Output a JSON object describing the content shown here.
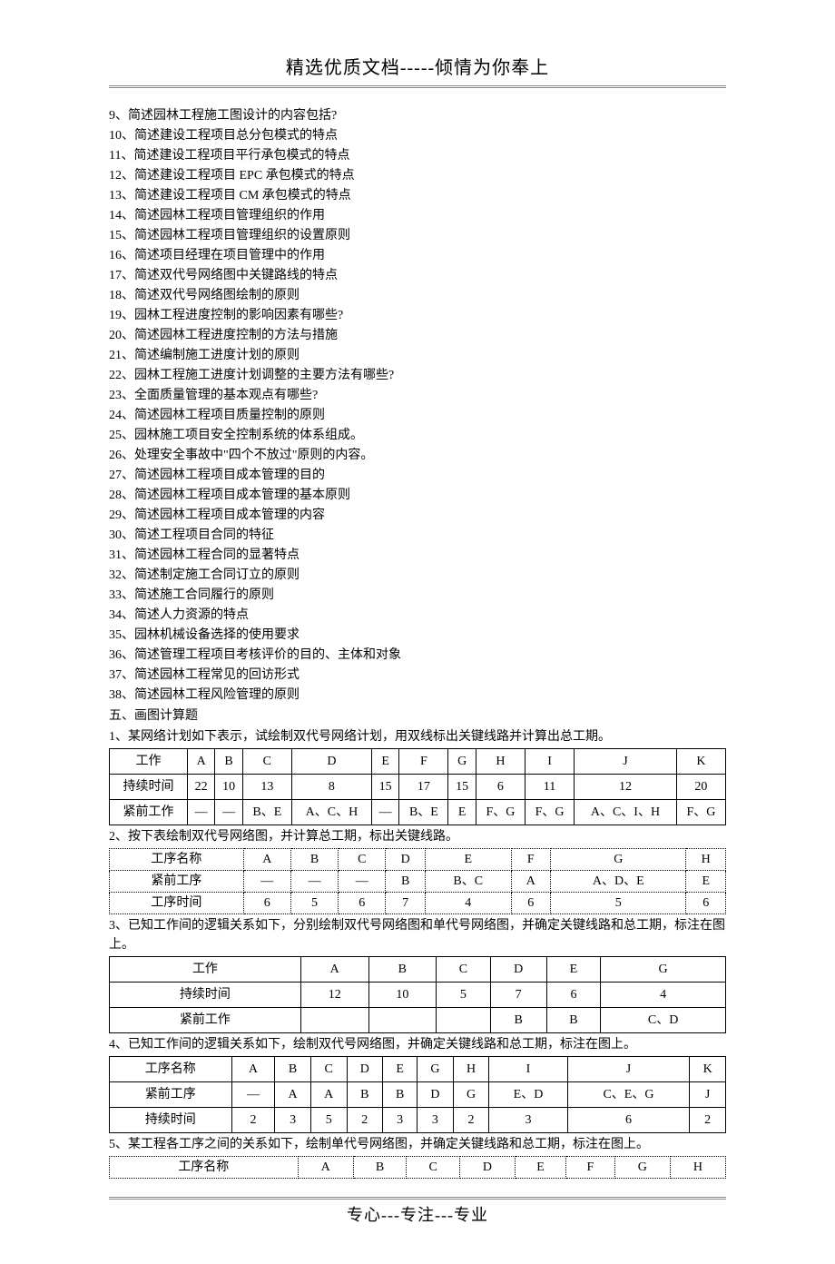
{
  "header": "精选优质文档-----倾情为你奉上",
  "footer": "专心---专注---专业",
  "questions": [
    "9、简述园林工程施工图设计的内容包括?",
    "10、简述建设工程项目总分包模式的特点",
    "11、简述建设工程项目平行承包模式的特点",
    "12、简述建设工程项目 EPC 承包模式的特点",
    "13、简述建设工程项目 CM 承包模式的特点",
    "14、简述园林工程项目管理组织的作用",
    "15、简述园林工程项目管理组织的设置原则",
    "16、简述项目经理在项目管理中的作用",
    "17、简述双代号网络图中关键路线的特点",
    "18、简述双代号网络图绘制的原则",
    "19、园林工程进度控制的影响因素有哪些?",
    "20、简述园林工程进度控制的方法与措施",
    "21、简述编制施工进度计划的原则",
    "22、园林工程施工进度计划调整的主要方法有哪些?",
    "23、全面质量管理的基本观点有哪些?",
    "24、简述园林工程项目质量控制的原则",
    "25、园林施工项目安全控制系统的体系组成。",
    "26、处理安全事故中\"四个不放过\"原则的内容。",
    "27、简述园林工程项目成本管理的目的",
    "28、简述园林工程项目成本管理的基本原则",
    "29、简述园林工程项目成本管理的内容",
    "30、简述工程项目合同的特征",
    "31、简述园林工程合同的显著特点",
    "32、简述制定施工合同订立的原则",
    "33、简述施工合同履行的原则",
    "34、简述人力资源的特点",
    "35、园林机械设备选择的使用要求",
    "36、简述管理工程项目考核评价的目的、主体和对象",
    "37、简述园林工程常见的回访形式",
    "38、简述园林工程风险管理的原则"
  ],
  "section5": "五、画图计算题",
  "problem1": {
    "text": "1、某网络计划如下表示，试绘制双代号网络计划，用双线标出关键线路并计算出总工期。",
    "rows": [
      [
        "工作",
        "A",
        "B",
        "C",
        "D",
        "E",
        "F",
        "G",
        "H",
        "I",
        "J",
        "K"
      ],
      [
        "持续时间",
        "22",
        "10",
        "13",
        "8",
        "15",
        "17",
        "15",
        "6",
        "11",
        "12",
        "20"
      ],
      [
        "紧前工作",
        "—",
        "—",
        "B、E",
        "A、C、H",
        "—",
        "B、E",
        "E",
        "F、G",
        "F、G",
        "A、C、I、H",
        "F、G"
      ]
    ]
  },
  "problem2": {
    "text": "2、按下表绘制双代号网络图，并计算总工期，标出关键线路。",
    "rows": [
      [
        "工序名称",
        "A",
        "B",
        "C",
        "D",
        "E",
        "F",
        "G",
        "H"
      ],
      [
        "紧前工序",
        "—",
        "—",
        "—",
        "B",
        "B、C",
        "A",
        "A、D、E",
        "E"
      ],
      [
        "工序时间",
        "6",
        "5",
        "6",
        "7",
        "4",
        "6",
        "5",
        "6"
      ]
    ]
  },
  "problem3": {
    "text": "3、已知工作间的逻辑关系如下，分别绘制双代号网络图和单代号网络图，并确定关键线路和总工期，标注在图上。",
    "rows": [
      [
        "工作",
        "A",
        "B",
        "C",
        "D",
        "E",
        "G"
      ],
      [
        "持续时间",
        "12",
        "10",
        "5",
        "7",
        "6",
        "4"
      ],
      [
        "紧前工作",
        "",
        "",
        "",
        "B",
        "B",
        "C、D"
      ]
    ]
  },
  "problem4": {
    "text": "4、已知工作间的逻辑关系如下，绘制双代号网络图，并确定关键线路和总工期，标注在图上。",
    "rows": [
      [
        "工序名称",
        "A",
        "B",
        "C",
        "D",
        "E",
        "G",
        "H",
        "I",
        "J",
        "K"
      ],
      [
        "紧前工序",
        "—",
        "A",
        "A",
        "B",
        "B",
        "D",
        "G",
        "E、D",
        "C、E、G",
        "J"
      ],
      [
        "持续时间",
        "2",
        "3",
        "5",
        "2",
        "3",
        "3",
        "2",
        "3",
        "6",
        "2"
      ]
    ]
  },
  "problem5": {
    "text": "5、某工程各工序之间的关系如下，绘制单代号网络图，并确定关键线路和总工期，标注在图上。",
    "rows": [
      [
        "工序名称",
        "A",
        "B",
        "C",
        "D",
        "E",
        "F",
        "G",
        "H"
      ]
    ]
  }
}
